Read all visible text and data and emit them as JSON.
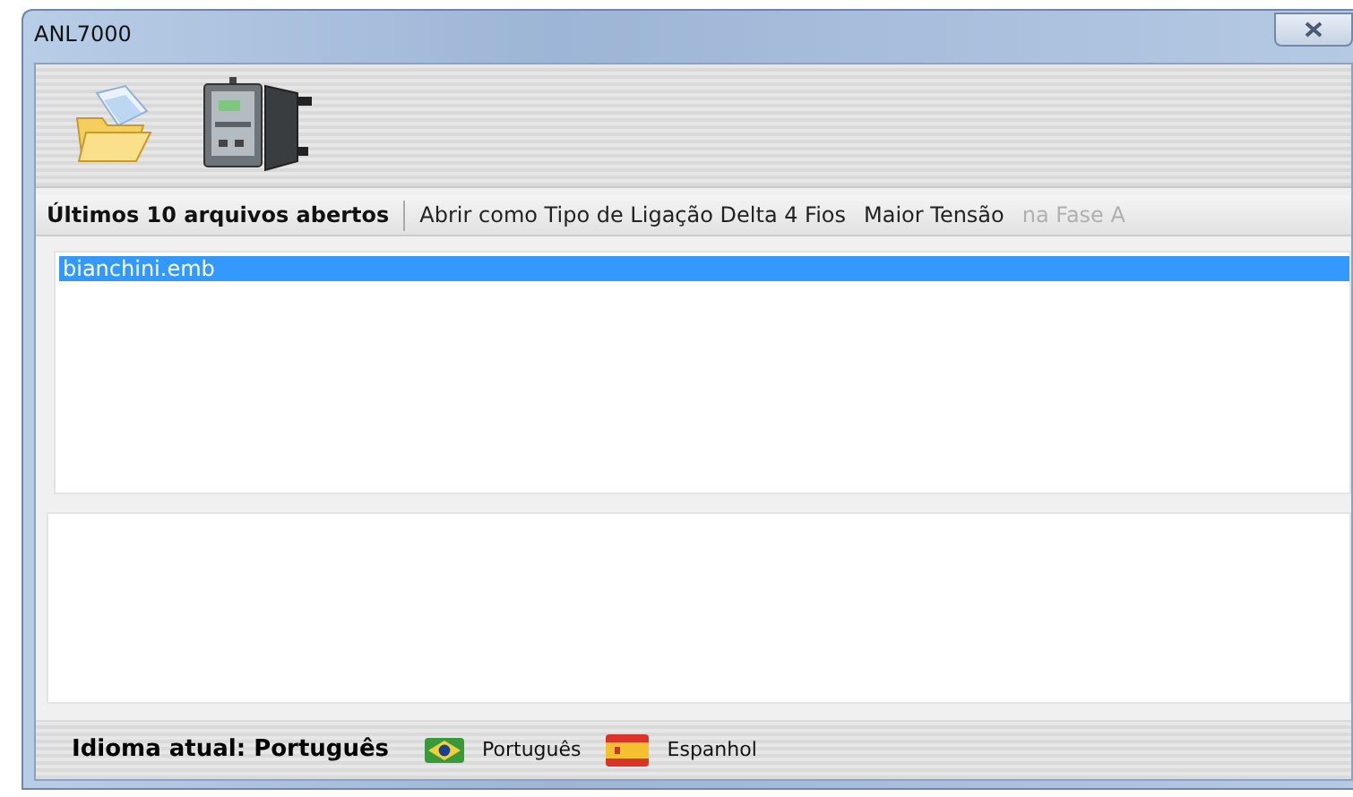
{
  "window": {
    "title": "ANL7000"
  },
  "toolbar": {
    "buttons": [
      {
        "kind": "open-folder"
      },
      {
        "kind": "meter"
      }
    ]
  },
  "menu_strip": {
    "label": "Últimos 10 arquivos abertos",
    "items": [
      {
        "label": "Abrir como Tipo de Ligação Delta 4 Fios",
        "disabled": false
      },
      {
        "label": "Maior Tensão",
        "disabled": false
      },
      {
        "label": "na Fase A",
        "disabled": true
      }
    ]
  },
  "file_list": {
    "items": [
      {
        "name": "bianchini.emb",
        "selected": true
      }
    ]
  },
  "status_bar": {
    "current_language": "Idioma atual: Português",
    "languages": [
      {
        "label": "Português",
        "kind": "brazil"
      },
      {
        "label": "Espanhol",
        "kind": "spain"
      }
    ]
  }
}
